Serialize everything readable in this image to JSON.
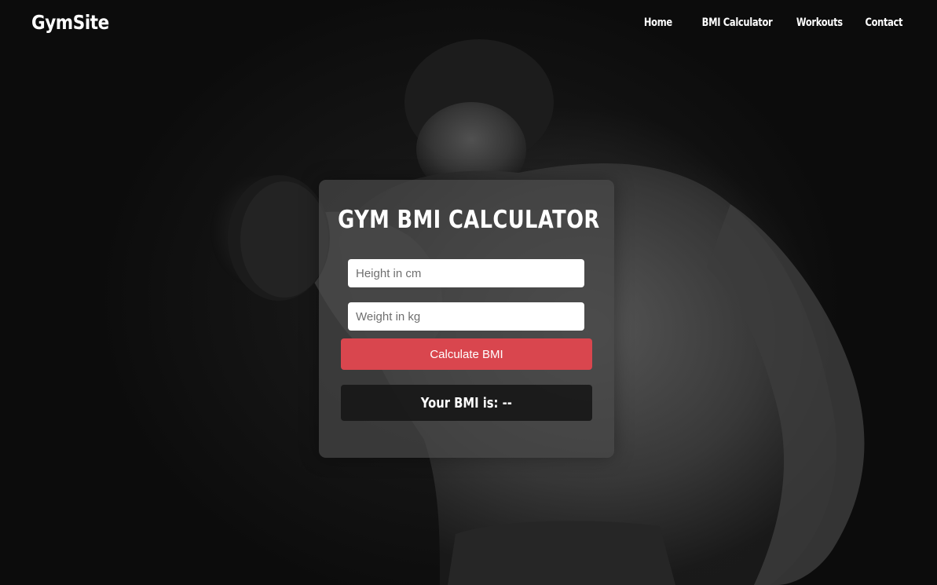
{
  "header": {
    "brand": "GymSite",
    "nav": [
      {
        "label": "Home"
      },
      {
        "label": "BMI Calculator"
      },
      {
        "label": "Workouts"
      },
      {
        "label": "Contact"
      }
    ]
  },
  "calculator": {
    "title": "GYM BMI CALCULATOR",
    "height_placeholder": "Height in cm",
    "weight_placeholder": "Weight in kg",
    "button_label": "Calculate BMI",
    "result_prefix": "Your BMI is:",
    "result_value": "--"
  },
  "colors": {
    "accent": "#d9464e",
    "background": "#0b0b0b",
    "card": "#484848"
  }
}
